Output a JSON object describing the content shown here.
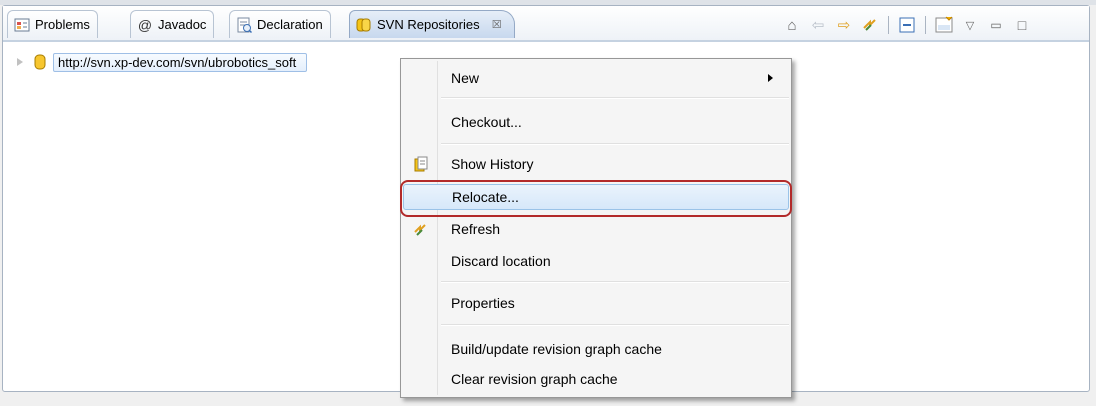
{
  "tabs": [
    {
      "label": "Problems",
      "icon": "problems-icon",
      "active": false
    },
    {
      "label": "Javadoc",
      "icon": "at-icon",
      "active": false
    },
    {
      "label": "Declaration",
      "icon": "declaration-icon",
      "active": false
    },
    {
      "label": "SVN Repositories",
      "icon": "svn-repositories-icon",
      "active": true
    }
  ],
  "tab_close_glyph": "☒",
  "toolbar": {
    "buttons": [
      "home-icon",
      "back-arrow-icon",
      "forward-arrow-icon",
      "refresh-icon",
      "collapse-all-icon",
      "svn-new-location-icon",
      "view-menu-icon",
      "minimize-icon",
      "maximize-icon"
    ]
  },
  "tree": {
    "repo_url": "http://svn.xp-dev.com/svn/ubrobotics_soft"
  },
  "context_menu": {
    "items": [
      {
        "label": "New",
        "submenu": true
      },
      {
        "label": "Checkout..."
      },
      {
        "label": "Show History",
        "icon": "history-icon"
      },
      {
        "label": "Relocate...",
        "highlighted": true
      },
      {
        "label": "Refresh",
        "icon": "refresh-icon"
      },
      {
        "label": "Discard location"
      },
      {
        "label": "Properties"
      },
      {
        "label": "Build/update revision graph cache"
      },
      {
        "label": "Clear revision graph cache"
      }
    ]
  },
  "colors": {
    "highlight": "#d6e8fa",
    "callout_border": "#b22a2a",
    "panel_border": "#a7b3c2"
  }
}
